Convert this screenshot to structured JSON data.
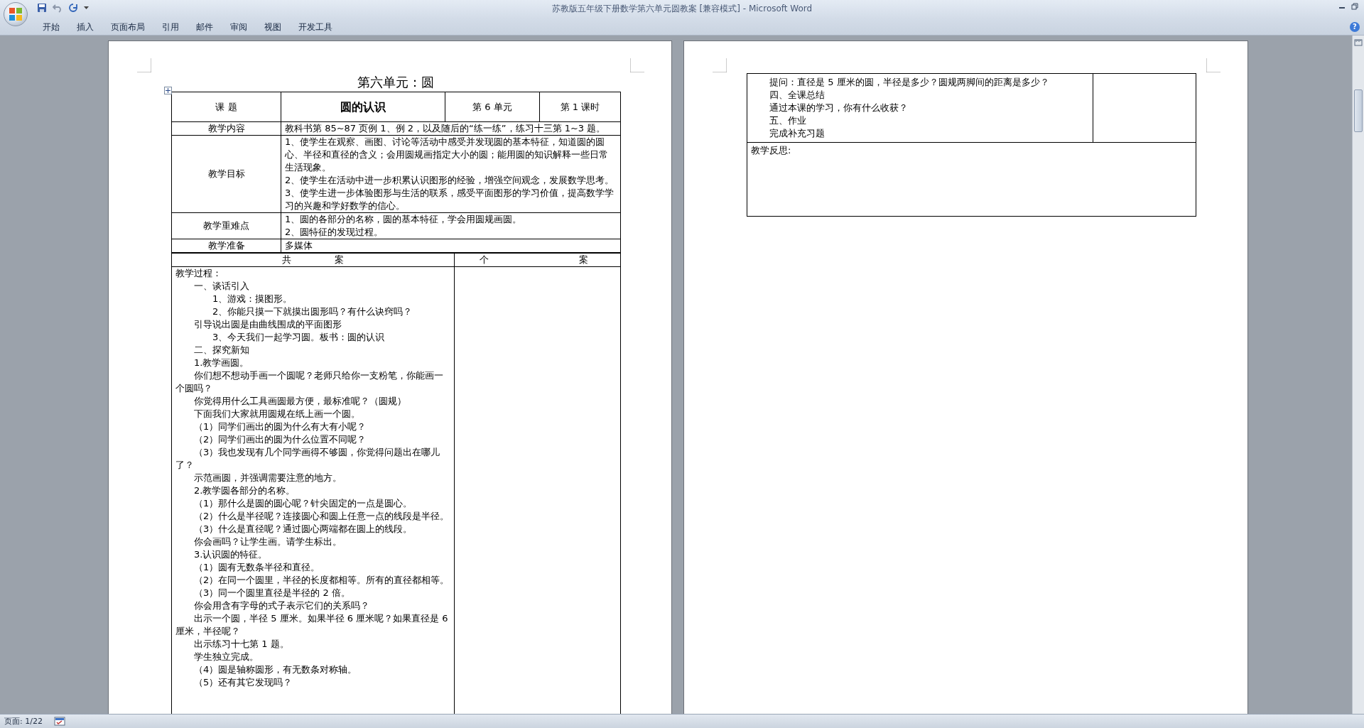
{
  "window": {
    "title": "苏教版五年级下册数学第六单元圆教案 [兼容模式] - Microsoft Word"
  },
  "ribbon_tabs": [
    {
      "label": "开始"
    },
    {
      "label": "插入"
    },
    {
      "label": "页面布局"
    },
    {
      "label": "引用"
    },
    {
      "label": "邮件"
    },
    {
      "label": "审阅"
    },
    {
      "label": "视图"
    },
    {
      "label": "开发工具"
    }
  ],
  "help_button": "?",
  "page_1": {
    "heading": "第六单元：圆",
    "header_row": {
      "label": "课 题",
      "title": "圆的认识",
      "unit": "第 6 单元",
      "period": "第 1 课时"
    },
    "info_rows": [
      {
        "label": "教学内容",
        "lines": [
          "教科书第 85~87 页例 1、例 2，以及随后的“练一练”，练习十三第 1~3 题。"
        ]
      },
      {
        "label": "教学目标",
        "lines": [
          "1、使学生在观察、画图、讨论等活动中感受并发现圆的基本特征，知道圆的圆心、半径和直径的含义；会用圆规画指定大小的圆；能用圆的知识解释一些日常生活现象。",
          "2、使学生在活动中进一步积累认识图形的经验，增强空间观念，发展数学思考。",
          "3、使学生进一步体验图形与生活的联系，感受平面图形的学习价值，提高数学学习的兴趣和学好数学的信心。"
        ]
      },
      {
        "label": "教学重难点",
        "lines": [
          "1、圆的各部分的名称，圆的基本特征，学会用圆规画圆。",
          "2、圆特征的发现过程。"
        ]
      },
      {
        "label": "教学准备",
        "lines": [
          "多媒体"
        ]
      }
    ],
    "plan_headers": [
      [
        "共",
        "案"
      ],
      [
        "个",
        "案"
      ]
    ],
    "process": [
      {
        "kind": "flush",
        "text": "教学过程："
      },
      {
        "kind": "indent",
        "text": "一、谈话引入"
      },
      {
        "kind": "deep",
        "text": "1、游戏：摸图形。"
      },
      {
        "kind": "deep",
        "text": "2、你能只摸一下就摸出圆形吗？有什么诀窍吗？"
      },
      {
        "kind": "indent",
        "text": "引导说出圆是由曲线围成的平面图形"
      },
      {
        "kind": "deep",
        "text": "3、今天我们一起学习圆。板书：圆的认识"
      },
      {
        "kind": "indent",
        "text": "二、探究新知"
      },
      {
        "kind": "indent",
        "text": "1.教学画圆。"
      },
      {
        "kind": "indent",
        "text": "你们想不想动手画一个圆呢？老师只给你一支粉笔，你能画一个圆吗？"
      },
      {
        "kind": "indent",
        "text": "你觉得用什么工具画圆最方便，最标准呢？（圆规）"
      },
      {
        "kind": "indent",
        "text": "下面我们大家就用圆规在纸上画一个圆。"
      },
      {
        "kind": "indent",
        "text": "（1）同学们画出的圆为什么有大有小呢？"
      },
      {
        "kind": "indent",
        "text": "（2）同学们画出的圆为什么位置不同呢？"
      },
      {
        "kind": "indent",
        "text": "（3）我也发现有几个同学画得不够圆，你觉得问题出在哪儿了？"
      },
      {
        "kind": "indent",
        "text": "示范画圆，并强调需要注意的地方。"
      },
      {
        "kind": "indent",
        "text": "2.教学圆各部分的名称。"
      },
      {
        "kind": "indent",
        "text": "（1）那什么是圆的圆心呢？针尖固定的一点是圆心。"
      },
      {
        "kind": "indent",
        "text": "（2）什么是半径呢？连接圆心和圆上任意一点的线段是半径。"
      },
      {
        "kind": "indent",
        "text": "（3）什么是直径呢？通过圆心两端都在圆上的线段。"
      },
      {
        "kind": "indent",
        "text": "你会画吗？让学生画。请学生标出。"
      },
      {
        "kind": "indent",
        "text": "3.认识圆的特征。"
      },
      {
        "kind": "indent",
        "text": "（1）圆有无数条半径和直径。"
      },
      {
        "kind": "indent",
        "text": "（2）在同一个圆里，半径的长度都相等。所有的直径都相等。"
      },
      {
        "kind": "indent",
        "text": "（3）同一个圆里直径是半径的 2 倍。"
      },
      {
        "kind": "indent",
        "text": "你会用含有字母的式子表示它们的关系吗？"
      },
      {
        "kind": "indent",
        "text": "出示一个圆，半径 5 厘米。如果半径 6 厘米呢？如果直径是 6 厘米，半径呢？"
      },
      {
        "kind": "indent",
        "text": "出示练习十七第 1 题。"
      },
      {
        "kind": "indent",
        "text": "学生独立完成。"
      },
      {
        "kind": "indent",
        "text": "（4）圆是轴称圆形，有无数条对称轴。"
      },
      {
        "kind": "indent",
        "text": "（5）还有其它发现吗？"
      }
    ]
  },
  "page_2": {
    "process": [
      {
        "kind": "indent",
        "text": "提问：直径是 5 厘米的圆，半径是多少？圆规两脚间的距离是多少？"
      },
      {
        "kind": "indent",
        "text": "四、全课总结"
      },
      {
        "kind": "indent",
        "text": "通过本课的学习，你有什么收获？"
      },
      {
        "kind": "indent",
        "text": "五、作业"
      },
      {
        "kind": "indent",
        "text": "完成补充习题"
      }
    ],
    "reflection_label": "教学反思:"
  },
  "status_bar": {
    "page": "页面: 1/22"
  }
}
